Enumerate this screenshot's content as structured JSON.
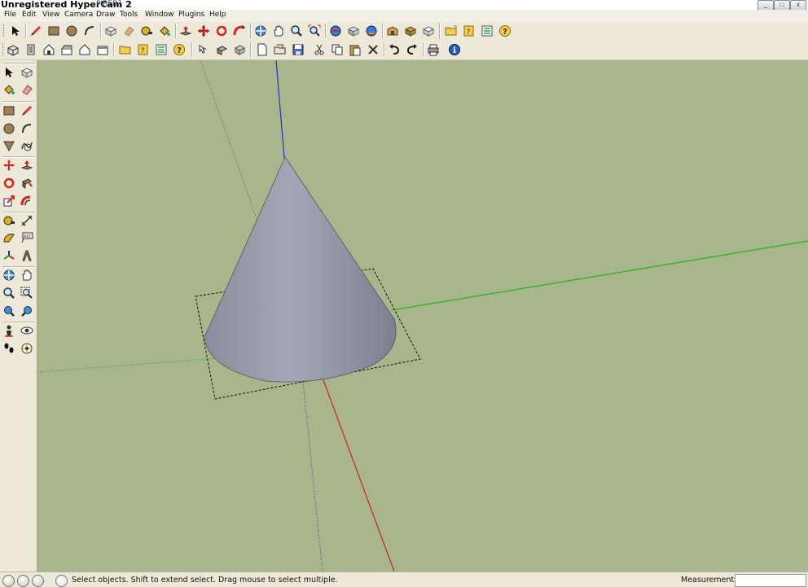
{
  "title": {
    "app": "Unregistered HyperCam 2",
    "overlay": "PIRED]"
  },
  "window_controls": {
    "minimize": "_",
    "maximize": "□",
    "close": "x"
  },
  "menu": [
    {
      "label": "File",
      "name": "menu-file"
    },
    {
      "label": "Edit",
      "name": "menu-edit"
    },
    {
      "label": "View",
      "name": "menu-view"
    },
    {
      "label": "Camera",
      "name": "menu-camera"
    },
    {
      "label": "Draw",
      "name": "menu-draw"
    },
    {
      "label": "Tools",
      "name": "menu-tools"
    },
    {
      "label": "Window",
      "name": "menu-window"
    },
    {
      "label": "Plugins",
      "name": "menu-plugins"
    },
    {
      "label": "Help",
      "name": "menu-help"
    }
  ],
  "toolbar1": [
    "select-icon",
    "pencil-icon",
    "rectangle-icon",
    "circle-icon",
    "arc-icon",
    "make-component-icon",
    "eraser-icon",
    "paint-bucket-icon",
    "tape-measure-icon",
    "push-pull-icon",
    "move-icon",
    "rotate-icon",
    "follow-me-icon",
    "orbit-icon",
    "pan-icon",
    "zoom-icon",
    "zoom-extents-icon",
    "get-models-icon",
    "share-model-icon",
    "share-component-icon",
    "warehouse-icon",
    "ruby-icon",
    "open-folder-icon",
    "help-icon",
    "outliner-icon",
    "question-icon"
  ],
  "toolbar2": [
    "iso-view-icon",
    "top-view-icon",
    "front-view-icon",
    "right-view-icon",
    "back-view-icon",
    "left-view-icon",
    "open-folder-icon",
    "help-icon",
    "layers-icon",
    "question-icon",
    "x-ray-icon",
    "hidden-line-icon",
    "shaded-icon",
    "new-file-icon",
    "open-file-icon",
    "save-icon",
    "cut-icon",
    "copy-icon",
    "paste-icon",
    "delete-icon",
    "undo-icon",
    "redo-icon",
    "print-icon",
    "model-info-icon"
  ],
  "left_tools": [
    [
      "select-icon",
      "eraser-icon"
    ],
    [
      "paint-bucket-icon",
      "eraser-pink-icon"
    ],
    [
      "rectangle-icon",
      "pencil-icon"
    ],
    [
      "circle-icon",
      "arc-icon"
    ],
    [
      "polygon-icon",
      "freehand-icon"
    ],
    [
      "move-icon",
      "push-pull-icon"
    ],
    [
      "rotate-icon",
      "follow-me-icon"
    ],
    [
      "scale-icon",
      "offset-icon"
    ],
    [
      "tape-measure-icon",
      "dimension-icon"
    ],
    [
      "protractor-icon",
      "text-icon"
    ],
    [
      "axes-icon",
      "3d-text-icon"
    ],
    [
      "orbit-icon",
      "pan-icon"
    ],
    [
      "zoom-icon",
      "zoom-window-icon"
    ],
    [
      "zoom-extents-icon",
      "previous-view-icon"
    ],
    [
      "position-camera-icon",
      "look-around-icon"
    ],
    [
      "walk-icon",
      "section-plane-icon"
    ]
  ],
  "status": {
    "text": "Select objects. Shift to extend select. Drag mouse to select multiple.",
    "measurements_label": "Measurements",
    "measurements_value": ""
  },
  "colors": {
    "viewport": "#a9b58a",
    "axis_red": "#cc2222",
    "axis_green": "#1fb51f",
    "axis_blue": "#2233cc",
    "cone": "#9a9dac"
  }
}
